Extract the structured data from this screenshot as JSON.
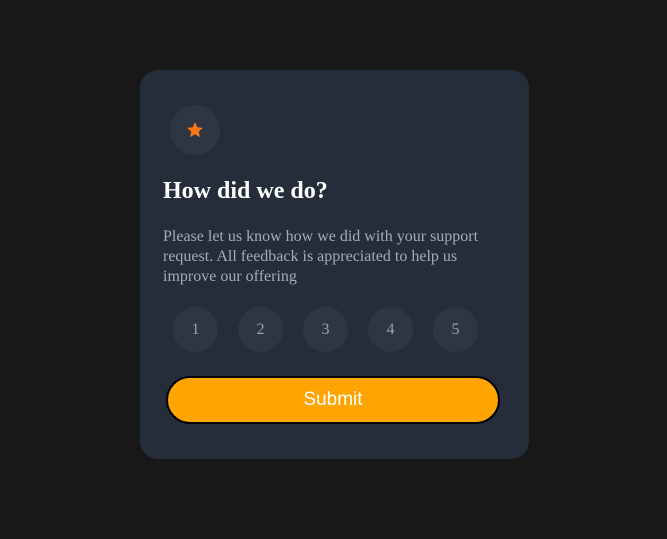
{
  "card": {
    "icon": "star-icon",
    "title": "How did we do?",
    "description": "Please let us know how we did with your support request. All feedback is appreciated to help us improve our offering",
    "ratings": [
      "1",
      "2",
      "3",
      "4",
      "5"
    ],
    "submit_label": "Submit"
  },
  "colors": {
    "page_background": "#181818",
    "card_background": "#252d3a",
    "circle_background": "#2e3543",
    "star": "#fc7614",
    "submit_background": "#ffa401"
  }
}
